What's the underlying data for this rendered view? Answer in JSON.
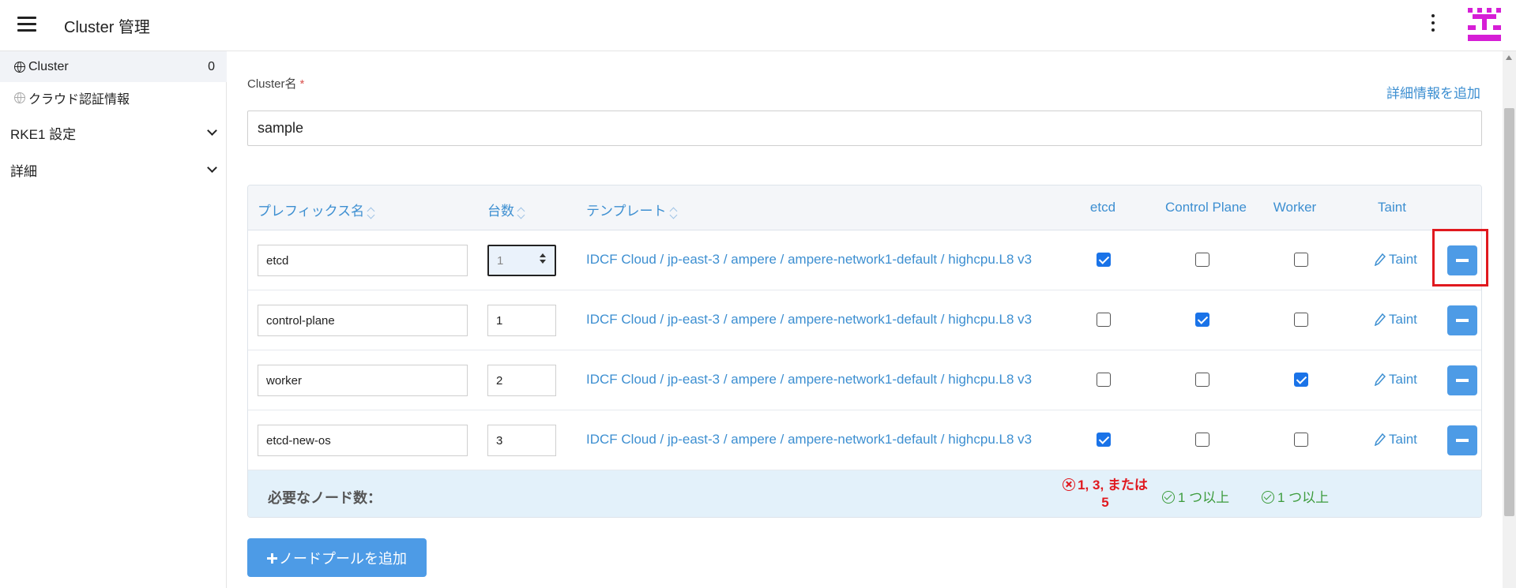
{
  "header": {
    "title": "Cluster 管理",
    "menu_icon": "hamburger-icon",
    "more_icon": "kebab-icon",
    "avatar_color": "#d61ed6"
  },
  "sidebar": {
    "items": [
      {
        "label": "Cluster",
        "count": "0",
        "icon": "globe-icon"
      },
      {
        "label": "クラウド認証情報",
        "icon": "globe-icon"
      },
      {
        "label": "RKE1 設定",
        "icon": "chevron-down-icon"
      },
      {
        "label": "詳細",
        "icon": "chevron-down-icon"
      }
    ]
  },
  "form": {
    "cluster_name_label": "Cluster名",
    "required_mark": "*",
    "cluster_name_value": "sample",
    "add_detail_link": "詳細情報を追加"
  },
  "table": {
    "headers": {
      "prefix": "プレフィックス名",
      "count": "台数",
      "template": "テンプレート",
      "etcd": "etcd",
      "control_plane": "Control Plane",
      "worker": "Worker",
      "taint": "Taint"
    },
    "rows": [
      {
        "prefix": "etcd",
        "count": "1",
        "template": "IDCF Cloud / jp-east-3 / ampere / ampere-network1-default / highcpu.L8 v3",
        "etcd": true,
        "control_plane": false,
        "worker": false,
        "taint": "Taint"
      },
      {
        "prefix": "control-plane",
        "count": "1",
        "template": "IDCF Cloud / jp-east-3 / ampere / ampere-network1-default / highcpu.L8 v3",
        "etcd": false,
        "control_plane": true,
        "worker": false,
        "taint": "Taint"
      },
      {
        "prefix": "worker",
        "count": "2",
        "template": "IDCF Cloud / jp-east-3 / ampere / ampere-network1-default / highcpu.L8 v3",
        "etcd": false,
        "control_plane": false,
        "worker": true,
        "taint": "Taint"
      },
      {
        "prefix": "etcd-new-os",
        "count": "3",
        "template": "IDCF Cloud / jp-east-3 / ampere / ampere-network1-default / highcpu.L8 v3",
        "etcd": true,
        "control_plane": false,
        "worker": false,
        "taint": "Taint"
      }
    ],
    "footer": {
      "label": "必要なノード数：",
      "etcd_status_line1": "1, 3, または",
      "etcd_status_line2": "5",
      "control_plane_status": "1 つ以上",
      "worker_status": "1 つ以上"
    }
  },
  "add_pool_button": "ノードプールを追加",
  "colors": {
    "link": "#3d8fd1",
    "button": "#4d9be6",
    "checkbox": "#1a73e8",
    "error": "#e0191f",
    "ok": "#3c9c3c",
    "highlight": "#e0191f"
  }
}
